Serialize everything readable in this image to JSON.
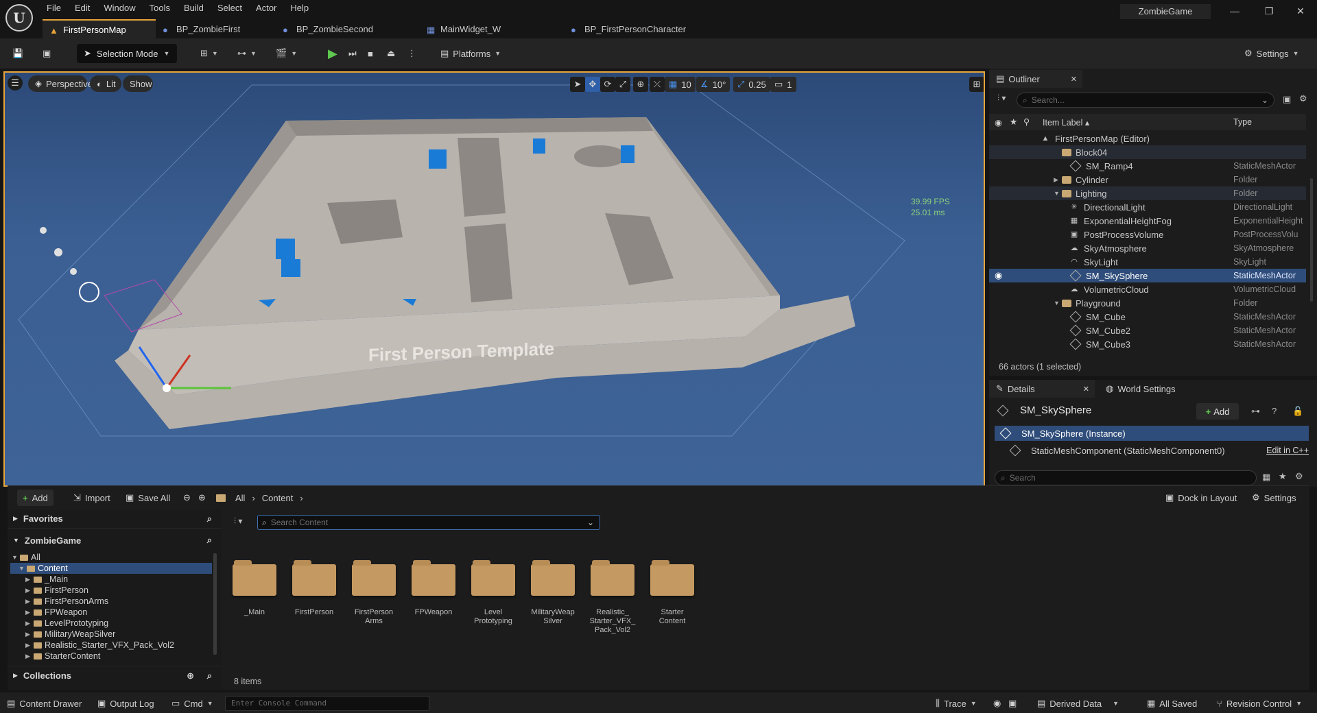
{
  "menu": [
    "File",
    "Edit",
    "Window",
    "Tools",
    "Build",
    "Select",
    "Actor",
    "Help"
  ],
  "tabs": [
    {
      "label": "FirstPersonMap",
      "active": true
    },
    {
      "label": "BP_ZombieFirst"
    },
    {
      "label": "BP_ZombieSecond"
    },
    {
      "label": "MainWidget_W"
    },
    {
      "label": "BP_FirstPersonCharacter"
    }
  ],
  "project_name": "ZombieGame",
  "toolbar": {
    "selection_mode": "Selection Mode",
    "platforms": "Platforms",
    "settings": "Settings"
  },
  "viewport": {
    "perspective": "Perspective",
    "lit": "Lit",
    "show": "Show",
    "grid_snap": "10",
    "rot_snap": "10°",
    "scale_snap": "0.25",
    "camera_speed": "1",
    "fps": "39.99 FPS",
    "ms": "25.01 ms",
    "wall_text": "First Person Template"
  },
  "outliner": {
    "tab": "Outliner",
    "search_placeholder": "Search...",
    "col_label": "Item Label ▴",
    "col_type": "Type",
    "rows": [
      {
        "label": "FirstPersonMap (Editor)",
        "type": ""
      },
      {
        "label": "Block04",
        "type": ""
      },
      {
        "label": "SM_Ramp4",
        "type": "StaticMeshActor"
      },
      {
        "label": "Cylinder",
        "type": "Folder"
      },
      {
        "label": "Lighting",
        "type": "Folder"
      },
      {
        "label": "DirectionalLight",
        "type": "DirectionalLight"
      },
      {
        "label": "ExponentialHeightFog",
        "type": "ExponentialHeight"
      },
      {
        "label": "PostProcessVolume",
        "type": "PostProcessVolu"
      },
      {
        "label": "SkyAtmosphere",
        "type": "SkyAtmosphere"
      },
      {
        "label": "SkyLight",
        "type": "SkyLight"
      },
      {
        "label": "SM_SkySphere",
        "type": "StaticMeshActor"
      },
      {
        "label": "VolumetricCloud",
        "type": "VolumetricCloud"
      },
      {
        "label": "Playground",
        "type": "Folder"
      },
      {
        "label": "SM_Cube",
        "type": "StaticMeshActor"
      },
      {
        "label": "SM_Cube2",
        "type": "StaticMeshActor"
      },
      {
        "label": "SM_Cube3",
        "type": "StaticMeshActor"
      }
    ],
    "count": "66 actors (1 selected)"
  },
  "details": {
    "tab": "Details",
    "world_settings": "World Settings",
    "actor_name": "SM_SkySphere",
    "add": "Add",
    "instance": "SM_SkySphere (Instance)",
    "component": "StaticMeshComponent (StaticMeshComponent0)",
    "edit_cpp": "Edit in C++",
    "search_placeholder": "Search"
  },
  "content_browser": {
    "add": "Add",
    "import": "Import",
    "save_all": "Save All",
    "crumb_all": "All",
    "crumb_content": "Content",
    "dock": "Dock in Layout",
    "settings": "Settings",
    "favorites": "Favorites",
    "project": "ZombieGame",
    "collections": "Collections",
    "search_placeholder": "Search Content",
    "tree": [
      {
        "label": "All"
      },
      {
        "label": "Content"
      },
      {
        "label": "_Main"
      },
      {
        "label": "FirstPerson"
      },
      {
        "label": "FirstPersonArms"
      },
      {
        "label": "FPWeapon"
      },
      {
        "label": "LevelPrototyping"
      },
      {
        "label": "MilitaryWeapSilver"
      },
      {
        "label": "Realistic_Starter_VFX_Pack_Vol2"
      },
      {
        "label": "StarterContent"
      }
    ],
    "folders": [
      "_Main",
      "FirstPerson",
      "FirstPerson Arms",
      "FPWeapon",
      "Level Prototyping",
      "MilitaryWeap Silver",
      "Realistic_ Starter_VFX_ Pack_Vol2",
      "Starter Content"
    ],
    "item_count": "8 items"
  },
  "statusbar": {
    "content_drawer": "Content Drawer",
    "output_log": "Output Log",
    "cmd": "Cmd",
    "console_placeholder": "Enter Console Command",
    "trace": "Trace",
    "derived_data": "Derived Data",
    "all_saved": "All Saved",
    "revision_control": "Revision Control"
  },
  "colors": {
    "accent": "#e7a43a",
    "selection": "#2f4d7a",
    "folder": "#c59a62",
    "viewport_sky": "#3e6396"
  }
}
